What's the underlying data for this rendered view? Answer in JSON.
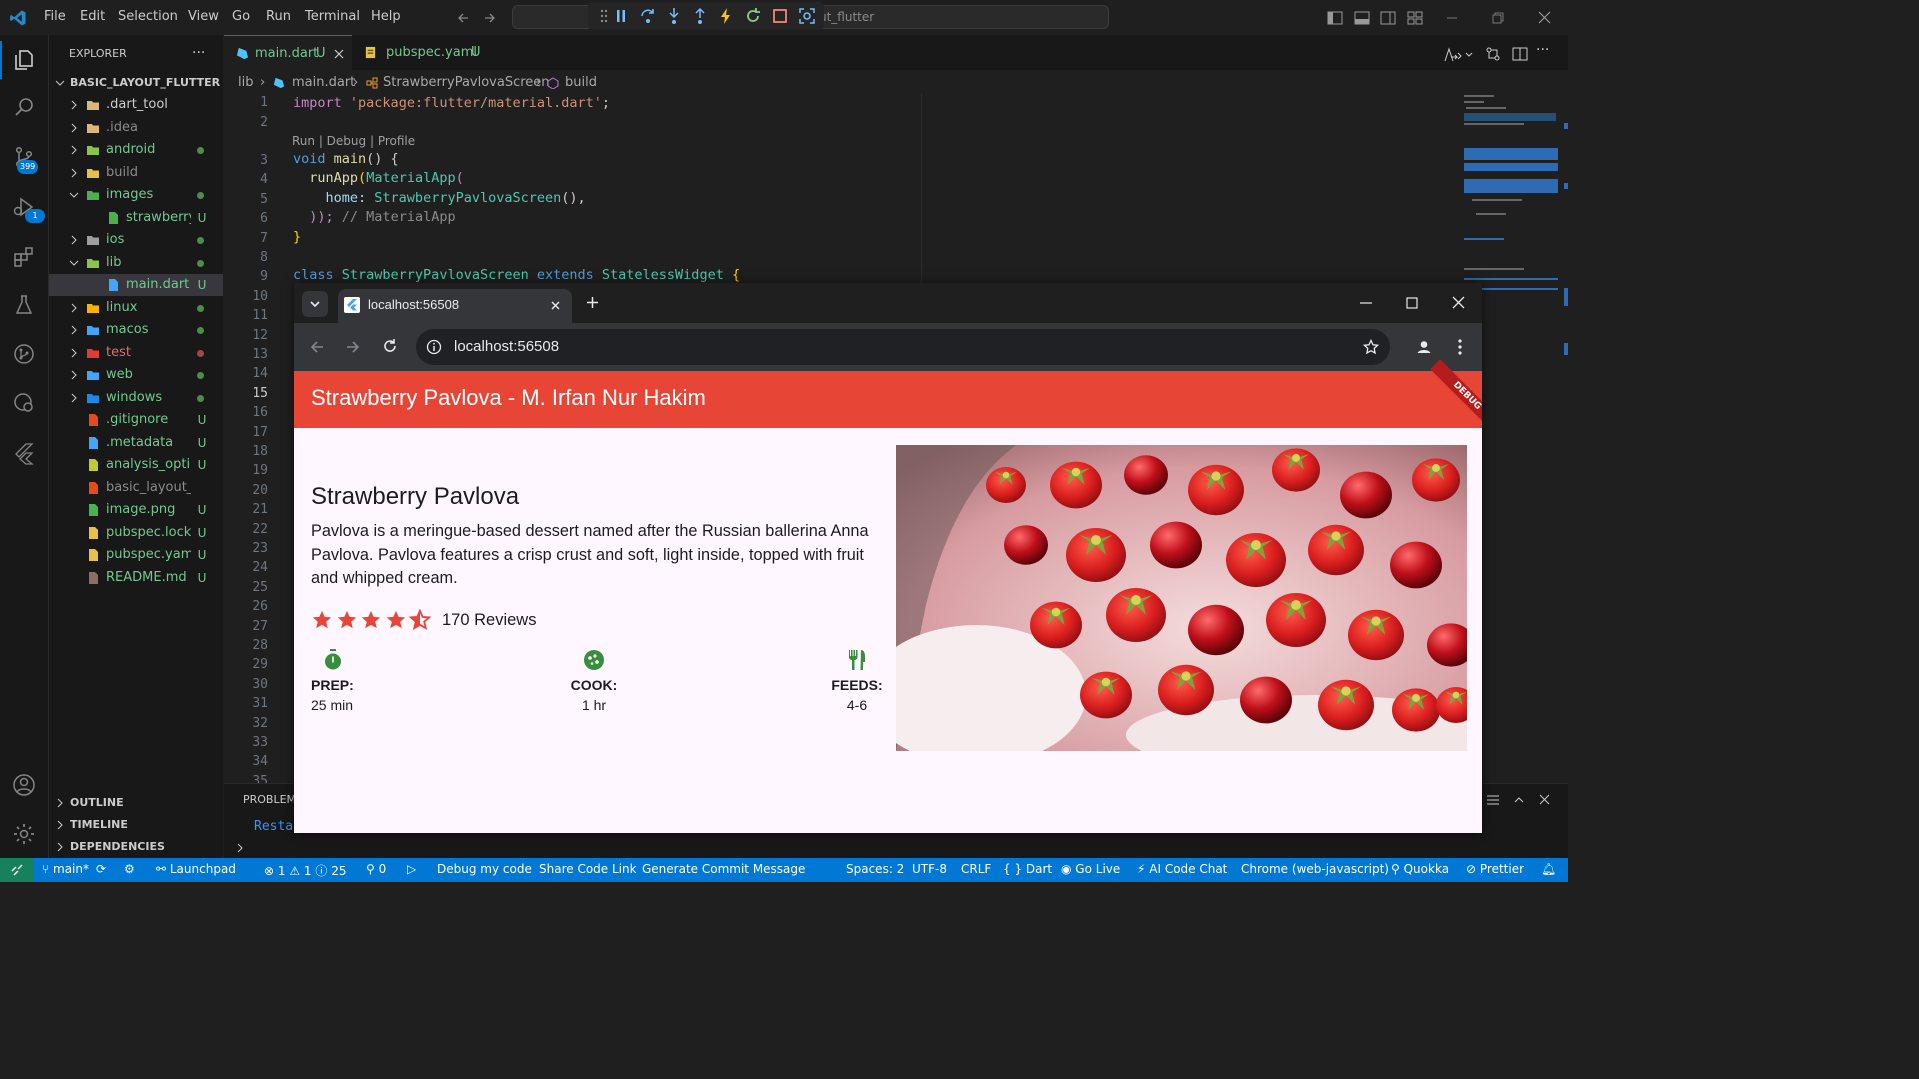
{
  "titlebar": {
    "menu": [
      "File",
      "Edit",
      "Selection",
      "View",
      "Go",
      "Run",
      "Terminal",
      "Help"
    ],
    "search_text": "ut_flutter"
  },
  "activity": {
    "scm_badge": "399",
    "debug_badge": "1"
  },
  "sidebar": {
    "title": "EXPLORER",
    "more": "...",
    "root": "BASIC_LAYOUT_FLUTTER",
    "items": [
      {
        "label": ".dart_tool",
        "status": ""
      },
      {
        "label": ".idea",
        "status": ""
      },
      {
        "label": "android",
        "status": "dot"
      },
      {
        "label": "build",
        "status": ""
      },
      {
        "label": "images",
        "status": "dot"
      },
      {
        "label": "strawberry_...",
        "status": "U"
      },
      {
        "label": "ios",
        "status": "dot"
      },
      {
        "label": "lib",
        "status": "dot"
      },
      {
        "label": "main.dart",
        "status": "U"
      },
      {
        "label": "linux",
        "status": "dot"
      },
      {
        "label": "macos",
        "status": "dot"
      },
      {
        "label": "test",
        "status": "dot"
      },
      {
        "label": "web",
        "status": "dot"
      },
      {
        "label": "windows",
        "status": "dot"
      },
      {
        "label": ".gitignore",
        "status": "U"
      },
      {
        "label": ".metadata",
        "status": "U"
      },
      {
        "label": "analysis_opti...",
        "status": "U"
      },
      {
        "label": "basic_layout_flutt...",
        "status": ""
      },
      {
        "label": "image.png",
        "status": "U"
      },
      {
        "label": "pubspec.lock",
        "status": "U"
      },
      {
        "label": "pubspec.yaml",
        "status": "U"
      },
      {
        "label": "README.md",
        "status": "U"
      }
    ],
    "sections": [
      "OUTLINE",
      "TIMELINE",
      "DEPENDENCIES"
    ]
  },
  "editor": {
    "tabs": [
      {
        "label": "main.dart",
        "status": "U"
      },
      {
        "label": "pubspec.yaml",
        "status": "U"
      }
    ],
    "breadcrumb": [
      "lib",
      "main.dart",
      "StrawberryPavlovaScreen",
      "build"
    ],
    "codelens": "Run | Debug | Profile",
    "line_numbers": [
      "1",
      "2",
      "3",
      "4",
      "5",
      "6",
      "7",
      "8",
      "9",
      "10",
      "11",
      "12",
      "13",
      "14",
      "15",
      "16",
      "17",
      "18",
      "19",
      "20",
      "21",
      "22",
      "23",
      "24",
      "25",
      "26",
      "27",
      "28",
      "29",
      "30",
      "31",
      "32",
      "33",
      "34",
      "35"
    ],
    "code": {
      "l1_kw": "import",
      "l1_str": "'package:flutter/material.dart'",
      "l1_end": ";",
      "l3_kw": "void",
      "l3_fn": "main",
      "l3_rest": "() {",
      "l4_fn": "runApp",
      "l4_cls": "MaterialApp",
      "l4_rest": "(",
      "l5_prop": "home",
      "l5_cls": "StrawberryPavlovaScreen",
      "l5_rest": "(),",
      "l6_rest": "));",
      "l6_cm": "// MaterialApp",
      "l7": "}",
      "l9_kw": "class",
      "l9_cls": "StrawberryPavlovaScreen",
      "l9_kw2": "extends",
      "l9_cls2": "StatelessWidget",
      "l9_rest": "{"
    },
    "panel_tab": "PROBLEMS",
    "panel_text": "Resta"
  },
  "browser": {
    "tab_title": "localhost:56508",
    "url": "localhost:56508",
    "appbar_title": "Strawberry Pavlova - M. Irfan Nur Hakim",
    "debug_banner": "DEBUG",
    "heading": "Strawberry Pavlova",
    "description": "Pavlova is a meringue-based dessert named after the Russian ballerina Anna Pavlova. Pavlova features a crisp crust and soft, light inside, topped with fruit and whipped cream.",
    "rating": 4.5,
    "reviews": "170 Reviews",
    "accent": "#e74536",
    "icon_color": "#388e3c",
    "info": [
      {
        "label": "PREP:",
        "value": "25 min",
        "icon": "timer-icon"
      },
      {
        "label": "COOK:",
        "value": "1 hr",
        "icon": "kitchen-icon"
      },
      {
        "label": "FEEDS:",
        "value": "4-6",
        "icon": "restaurant-icon"
      }
    ]
  },
  "statusbar": {
    "branch": "main*",
    "launchpad": "Launchpad",
    "errors": "1",
    "warnings": "1",
    "infos": "25",
    "ports": "0",
    "debug": "Debug my code",
    "share": "Share Code Link",
    "commit": "Generate Commit Message",
    "spaces": "Spaces: 2",
    "encoding": "UTF-8",
    "eol": "CRLF",
    "language": "Dart",
    "golive": "Go Live",
    "aichat": "AI Code Chat",
    "device": "Chrome (web-javascript)",
    "quokka": "Quokka",
    "prettier": "Prettier"
  }
}
